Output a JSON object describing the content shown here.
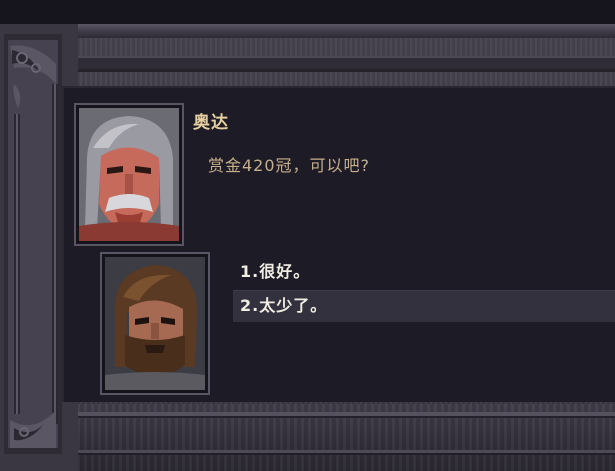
{
  "dialogue": {
    "speaker_name": "奥达",
    "speech_text": "赏金420冠，可以吧?",
    "options": [
      {
        "label": "1.很好。",
        "selected": false
      },
      {
        "label": "2.太少了。",
        "selected": true
      }
    ]
  },
  "portraits": {
    "speaker_icon": "old-grey-haired-man-portrait",
    "player_icon": "bearded-brown-haired-man-portrait"
  },
  "colors": {
    "speaker_name": "#e6cfa1",
    "speech_text": "#c7af8b",
    "option_text": "#f1ede3",
    "selected_option_bg": "#33313d",
    "panel_bg": "#1d1b25",
    "frame": "#403d49"
  }
}
